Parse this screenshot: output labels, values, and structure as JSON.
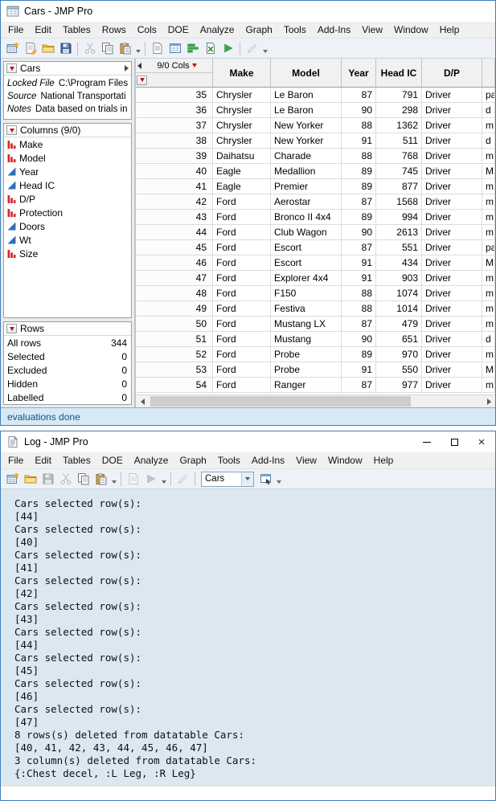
{
  "colors": {
    "window_border": "#3e7dbd",
    "red_triangle": "#c41212",
    "log_background": "#dbe8f1",
    "status_background": "#d8e9f6",
    "status_text": "#174f7c",
    "nominal_icon": "#d42424",
    "continuous_icon": "#2f6fb2"
  },
  "cars_window": {
    "title": "Cars - JMP Pro",
    "menu_items": [
      "File",
      "Edit",
      "Tables",
      "Rows",
      "Cols",
      "DOE",
      "Analyze",
      "Graph",
      "Tools",
      "Add-Ins",
      "View",
      "Window",
      "Help"
    ],
    "toolbar_icons": [
      "new-data-table",
      "new-journal",
      "open-file",
      "save",
      "cut",
      "copy",
      "paste",
      "new-script",
      "data-view",
      "graph-builder",
      "excel-import",
      "run-script",
      "annotate-pen"
    ],
    "side_panel": {
      "table_panel": {
        "title": "Cars",
        "properties": [
          {
            "label": "Locked File",
            "value": "C:\\Program Files\\"
          },
          {
            "label": "Source",
            "value": "National Transportati"
          },
          {
            "label": "Notes",
            "value": "Data based on trials in"
          }
        ]
      },
      "columns_panel": {
        "title": "Columns (9/0)",
        "items": [
          {
            "name": "Make",
            "type": "nominal"
          },
          {
            "name": "Model",
            "type": "nominal"
          },
          {
            "name": "Year",
            "type": "continuous"
          },
          {
            "name": "Head IC",
            "type": "continuous"
          },
          {
            "name": "D/P",
            "type": "nominal"
          },
          {
            "name": "Protection",
            "type": "nominal"
          },
          {
            "name": "Doors",
            "type": "continuous"
          },
          {
            "name": "Wt",
            "type": "continuous"
          },
          {
            "name": "Size",
            "type": "nominal"
          }
        ]
      },
      "rows_panel": {
        "title": "Rows",
        "stats": [
          {
            "label": "All rows",
            "value": "344"
          },
          {
            "label": "Selected",
            "value": "0"
          },
          {
            "label": "Excluded",
            "value": "0"
          },
          {
            "label": "Hidden",
            "value": "0"
          },
          {
            "label": "Labelled",
            "value": "0"
          }
        ]
      }
    },
    "grid": {
      "corner_label": "9/0 Cols",
      "headers": [
        "Make",
        "Model",
        "Year",
        "Head IC",
        "D/P"
      ],
      "rows": [
        [
          "35",
          "Chrysler",
          "Le Baron",
          "87",
          "791",
          "Driver",
          "pa"
        ],
        [
          "36",
          "Chrysler",
          "Le Baron",
          "90",
          "298",
          "Driver",
          "d"
        ],
        [
          "37",
          "Chrysler",
          "New Yorker",
          "88",
          "1362",
          "Driver",
          "m"
        ],
        [
          "38",
          "Chrysler",
          "New Yorker",
          "91",
          "511",
          "Driver",
          "d"
        ],
        [
          "39",
          "Daihatsu",
          "Charade",
          "88",
          "768",
          "Driver",
          "m"
        ],
        [
          "40",
          "Eagle",
          "Medallion",
          "89",
          "745",
          "Driver",
          "M"
        ],
        [
          "41",
          "Eagle",
          "Premier",
          "89",
          "877",
          "Driver",
          "m"
        ],
        [
          "42",
          "Ford",
          "Aerostar",
          "87",
          "1568",
          "Driver",
          "m"
        ],
        [
          "43",
          "Ford",
          "Bronco II 4x4",
          "89",
          "994",
          "Driver",
          "m"
        ],
        [
          "44",
          "Ford",
          "Club Wagon",
          "90",
          "2613",
          "Driver",
          "m"
        ],
        [
          "45",
          "Ford",
          "Escort",
          "87",
          "551",
          "Driver",
          "pa"
        ],
        [
          "46",
          "Ford",
          "Escort",
          "91",
          "434",
          "Driver",
          "M"
        ],
        [
          "47",
          "Ford",
          "Explorer 4x4",
          "91",
          "903",
          "Driver",
          "m"
        ],
        [
          "48",
          "Ford",
          "F150",
          "88",
          "1074",
          "Driver",
          "m"
        ],
        [
          "49",
          "Ford",
          "Festiva",
          "88",
          "1014",
          "Driver",
          "m"
        ],
        [
          "50",
          "Ford",
          "Mustang LX",
          "87",
          "479",
          "Driver",
          "m"
        ],
        [
          "51",
          "Ford",
          "Mustang",
          "90",
          "651",
          "Driver",
          "d"
        ],
        [
          "52",
          "Ford",
          "Probe",
          "89",
          "970",
          "Driver",
          "m"
        ],
        [
          "53",
          "Ford",
          "Probe",
          "91",
          "550",
          "Driver",
          "M"
        ],
        [
          "54",
          "Ford",
          "Ranger",
          "87",
          "977",
          "Driver",
          "m"
        ]
      ]
    },
    "status_text": "evaluations done"
  },
  "log_window": {
    "title": "Log - JMP Pro",
    "window_controls": [
      "minimize",
      "maximize",
      "close"
    ],
    "menu_items": [
      "File",
      "Edit",
      "Tables",
      "DOE",
      "Analyze",
      "Graph",
      "Tools",
      "Add-Ins",
      "View",
      "Window",
      "Help"
    ],
    "toolbar": {
      "icons": [
        "new-data-table",
        "open-file",
        "save",
        "cut",
        "copy",
        "paste",
        "new-script",
        "run-script",
        "annotate-pen",
        "window-list"
      ],
      "table_selector": "Cars"
    },
    "lines": [
      "Cars selected row(s):",
      "[44]",
      "Cars selected row(s):",
      "[40]",
      "Cars selected row(s):",
      "[41]",
      "Cars selected row(s):",
      "[42]",
      "Cars selected row(s):",
      "[43]",
      "Cars selected row(s):",
      "[44]",
      "Cars selected row(s):",
      "[45]",
      "Cars selected row(s):",
      "[46]",
      "Cars selected row(s):",
      "[47]",
      "8 rows(s) deleted from datatable Cars:",
      "[40, 41, 42, 43, 44, 45, 46, 47]",
      "3 column(s) deleted from datatable Cars:",
      "{:Chest decel, :L Leg, :R Leg}"
    ]
  }
}
